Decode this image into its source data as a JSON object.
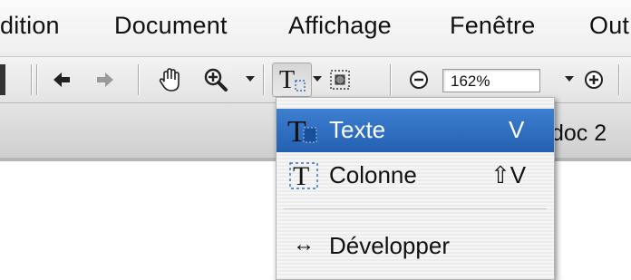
{
  "menubar": {
    "items": [
      "dition",
      "Document",
      "Affichage",
      "Fenêtre",
      "Out"
    ]
  },
  "toolbar": {
    "zoom_value": "162%",
    "icons": [
      "back-arrow-icon",
      "forward-arrow-icon",
      "hand-tool-icon",
      "zoom-in-tool-icon",
      "text-tool-icon",
      "image-tool-icon",
      "zoom-out-icon",
      "zoom-plus-icon"
    ]
  },
  "tabs": {
    "doc2_label": "doc 2"
  },
  "tool_menu": {
    "items": [
      {
        "label": "Texte",
        "shortcut": "V",
        "selected": true
      },
      {
        "label": "Colonne",
        "shortcut": "⇧V",
        "selected": false
      },
      {
        "label": "Développer",
        "shortcut": "",
        "selected": false
      }
    ],
    "develop_glyph": "↔"
  },
  "colors": {
    "selection": "#2f6fbf",
    "menubar_bg": "#f4f4f4"
  }
}
